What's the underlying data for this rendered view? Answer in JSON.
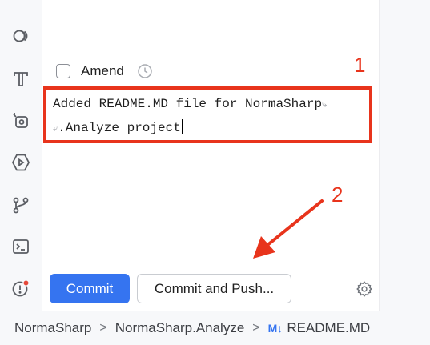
{
  "sidebar": {
    "icons": [
      "commit-icon",
      "text-format-icon",
      "ai-assistant-icon",
      "run-icon",
      "git-branch-icon",
      "terminal-icon",
      "problems-icon"
    ]
  },
  "commit_panel": {
    "amend_label": "Amend",
    "amend_checked": false,
    "message_line1": "Added README.MD file for NormaSharp",
    "message_line2": ".Analyze project",
    "annotation_1": "1",
    "annotation_2": "2",
    "commit_button": "Commit",
    "commit_push_button": "Commit and Push..."
  },
  "statusbar": {
    "crumbs": [
      "NormaSharp",
      "NormaSharp.Analyze",
      "README.MD"
    ],
    "file_icon_text": "M↓",
    "separator": ">"
  },
  "colors": {
    "accent": "#3574f0",
    "annotation": "#e8341c"
  }
}
